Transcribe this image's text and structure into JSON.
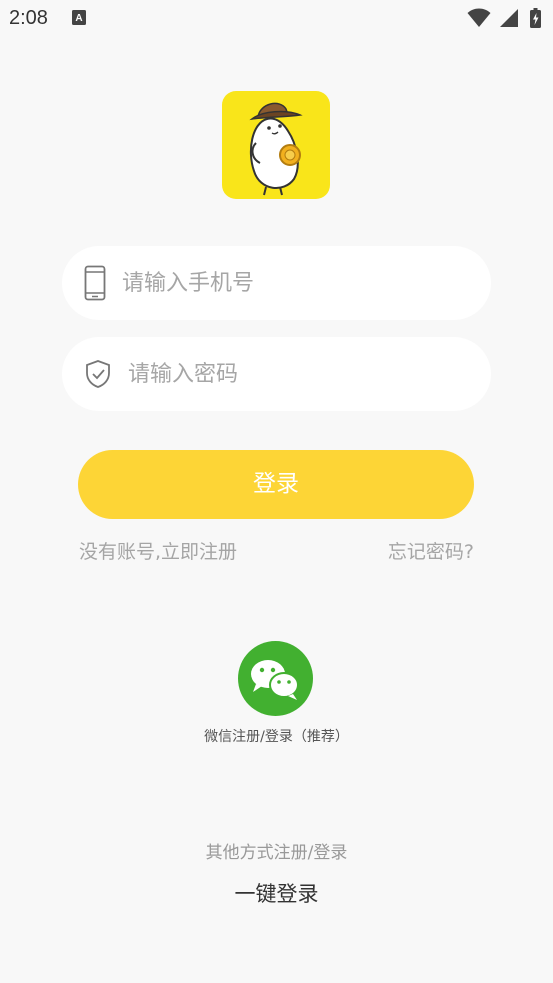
{
  "status_bar": {
    "time": "2:08",
    "icons": [
      "keyboard-a-icon",
      "wifi-icon",
      "signal-icon",
      "battery-icon"
    ]
  },
  "logo": {
    "icon": "app-logo-bean-mascot",
    "background": "#f9e51a"
  },
  "phone_input": {
    "placeholder": "请输入手机号",
    "value": "",
    "icon": "phone-icon"
  },
  "password_input": {
    "placeholder": "请输入密码",
    "value": "",
    "icon": "shield-check-icon"
  },
  "login_button": {
    "label": "登录",
    "color": "#fdd536"
  },
  "links": {
    "register": "没有账号,立即注册",
    "forgot": "忘记密码?"
  },
  "wechat": {
    "icon": "wechat-icon",
    "color": "#42b030",
    "label": "微信注册/登录（推荐）"
  },
  "other_methods": {
    "label": "其他方式注册/登录",
    "one_click": "一键登录"
  }
}
